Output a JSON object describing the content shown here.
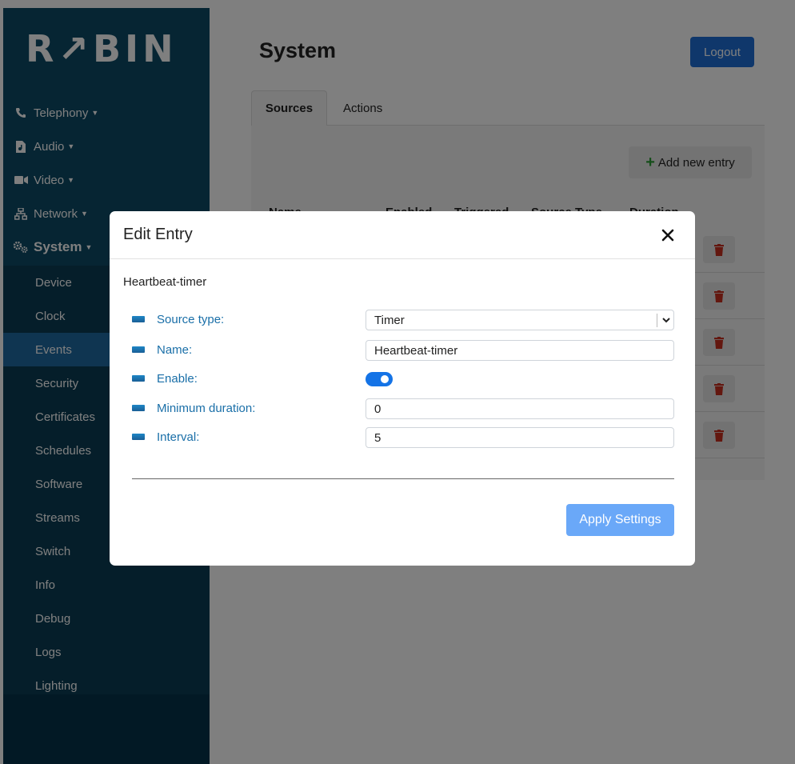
{
  "sidebar": {
    "logo": "R↗BIN",
    "menu": [
      {
        "label": "Telephony",
        "icon": "phone-icon"
      },
      {
        "label": "Audio",
        "icon": "audio-file-icon"
      },
      {
        "label": "Video",
        "icon": "video-camera-icon"
      },
      {
        "label": "Network",
        "icon": "network-icon"
      },
      {
        "label": "System",
        "icon": "gears-icon"
      }
    ],
    "submenu": [
      "Device",
      "Clock",
      "Events",
      "Security",
      "Certificates",
      "Schedules",
      "Software",
      "Streams",
      "Switch",
      "Info",
      "Debug",
      "Logs",
      "Lighting"
    ],
    "active_submenu": "Events"
  },
  "header": {
    "title": "System",
    "logout_label": "Logout"
  },
  "tabs": {
    "items": [
      "Sources",
      "Actions"
    ],
    "active": "Sources"
  },
  "panel": {
    "add_label": "Add new entry",
    "columns": [
      "Name",
      "Enabled",
      "Triggered",
      "Source Type",
      "Duration"
    ],
    "row_count": 5
  },
  "modal": {
    "title": "Edit Entry",
    "entry_name": "Heartbeat-timer",
    "fields": {
      "source_type": {
        "label": "Source type:",
        "value": "Timer"
      },
      "name": {
        "label": "Name:",
        "value": "Heartbeat-timer"
      },
      "enable": {
        "label": "Enable:",
        "checked": true
      },
      "minimum_duration": {
        "label": "Minimum duration:",
        "value": "0"
      },
      "interval": {
        "label": "Interval:",
        "value": "5"
      }
    },
    "apply_label": "Apply Settings"
  },
  "colors": {
    "sidebar_bg": "#0d4b66",
    "active_item": "#1f6aa3",
    "primary": "#1f6fd6",
    "label_blue": "#1a6fa8",
    "danger": "#c62f1f",
    "add_green": "#2a9d35"
  }
}
